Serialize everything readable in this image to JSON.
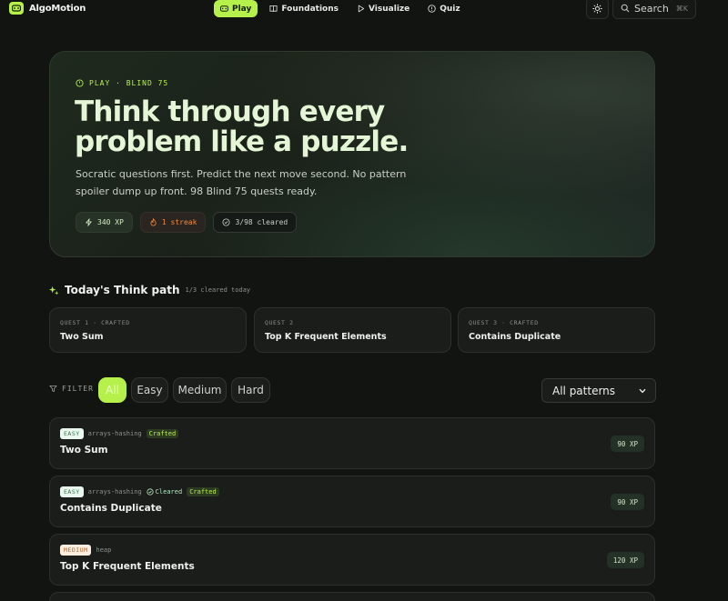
{
  "brand": {
    "name": "AlgoMotion",
    "logo_icon": "gamepad-icon"
  },
  "nav": {
    "links": [
      {
        "label": "Play",
        "icon": "gamepad-icon",
        "active": true
      },
      {
        "label": "Foundations",
        "icon": "book-icon",
        "active": false
      },
      {
        "label": "Visualize",
        "icon": "play-icon",
        "active": false
      },
      {
        "label": "Quiz",
        "icon": "help-circle-icon",
        "active": false
      }
    ],
    "theme_icon": "sun-icon",
    "search": {
      "label": "Search",
      "shortcut": "⌘K"
    }
  },
  "hero": {
    "eyebrow": "PLAY · BLIND 75",
    "title": "Think through every problem like a puzzle.",
    "subtitle": "Socratic questions first. Predict the next move second. No pattern spoiler dump up front. 98 Blind 75 quests ready.",
    "chips": [
      {
        "label": "340 XP",
        "icon": "zap-icon"
      },
      {
        "label": "1 streak",
        "icon": "flame-icon"
      },
      {
        "label": "3/98 cleared",
        "icon": "check-circle-icon"
      }
    ]
  },
  "today": {
    "title": "Today's Think path",
    "progress": "1/3 cleared today",
    "quests": [
      {
        "meta": "QUEST 1 · CRAFTED",
        "name": "Two Sum"
      },
      {
        "meta": "QUEST 2",
        "name": "Top K Frequent Elements"
      },
      {
        "meta": "QUEST 3 · CRAFTED",
        "name": "Contains Duplicate"
      }
    ]
  },
  "filters": {
    "label": "FILTER",
    "options": [
      "All",
      "Easy",
      "Medium",
      "Hard"
    ],
    "selected": "All",
    "pattern_select": "All patterns"
  },
  "problems": [
    {
      "difficulty": "EASY",
      "tag": "arrays-hashing",
      "cleared": null,
      "crafted": "Crafted",
      "title": "Two Sum",
      "xp": "90 XP"
    },
    {
      "difficulty": "EASY",
      "tag": "arrays-hashing",
      "cleared": "Cleared",
      "crafted": "Crafted",
      "title": "Contains Duplicate",
      "xp": "90 XP"
    },
    {
      "difficulty": "MEDIUM",
      "tag": "heap",
      "cleared": null,
      "crafted": null,
      "title": "Top K Frequent Elements",
      "xp": "120 XP"
    }
  ],
  "colors": {
    "accent": "#b6f04a",
    "background": "#121412",
    "streak": "#f08a3c"
  }
}
